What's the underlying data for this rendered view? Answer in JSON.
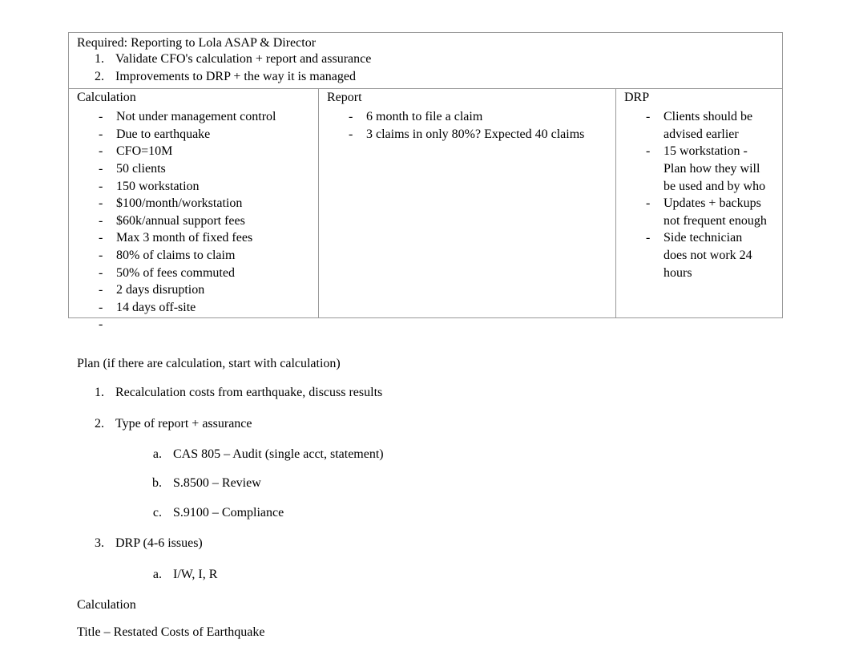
{
  "header": {
    "required": "Required: Reporting to Lola ASAP & Director",
    "items": [
      "Validate CFO's     calculation + report and assurance",
      "Improvements to DRP + the way it is managed"
    ]
  },
  "columns": {
    "calculation": {
      "title": "Calculation",
      "items": [
        "Not under management control",
        "Due to earthquake",
        "CFO=10M",
        "50 clients",
        "150 workstation",
        "$100/month/workstation",
        "$60k/annual support fees",
        "Max 3 month of fixed fees",
        "80% of claims to claim",
        "50% of fees commuted",
        "2 days disruption",
        "14 days off-site",
        ""
      ]
    },
    "report": {
      "title": "Report",
      "items": [
        "6 month to file a claim",
        "3 claims in only 80%? Expected 40 claims"
      ]
    },
    "drp": {
      "title": "DRP",
      "items": [
        "Clients should be advised earlier",
        "15 workstation - Plan how they will be used and by who",
        "Updates + backups not frequent enough",
        "Side technician does not work 24 hours"
      ]
    }
  },
  "plan": {
    "title": "Plan (if there are calculation, start with calculation)",
    "items": [
      {
        "text": "Recalculation costs from earthquake, discuss results",
        "sub": []
      },
      {
        "text": "Type of report + assurance",
        "sub": [
          "CAS 805 – Audit (single acct, statement)",
          "S.8500 – Review",
          "S.9100 – Compliance"
        ]
      },
      {
        "text": "DRP (4-6 issues)",
        "sub": [
          "I/W, I, R"
        ]
      }
    ]
  },
  "calculation_section": {
    "heading": "Calculation",
    "title_line": "Title – Restated Costs of Earthquake"
  }
}
